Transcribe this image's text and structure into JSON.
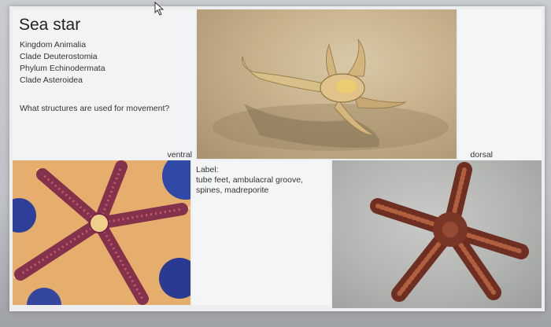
{
  "slide": {
    "title": "Sea star",
    "taxonomy": [
      "Kingdom Animalia",
      "Clade Deuterostomia",
      "Phylum Echinodermata",
      "Clade Asteroidea"
    ],
    "question": "What structures are used for movement?",
    "ventral_label": "ventral",
    "dorsal_label": "dorsal",
    "label_heading": "Label:",
    "label_terms": "tube feet, ambulacral groove, spines, madreporite"
  },
  "images": [
    {
      "subject": "sea star on sand (photo)"
    },
    {
      "subject": "sea star ventral side (photo)"
    },
    {
      "subject": "sea star dorsal side (photo)"
    }
  ]
}
